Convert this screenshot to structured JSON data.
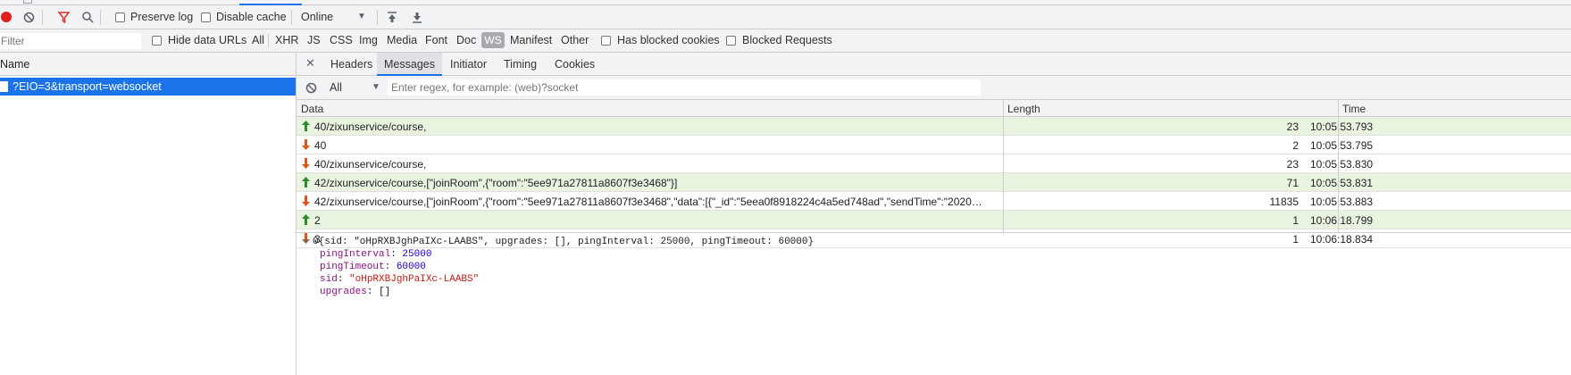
{
  "toolbar": {
    "preserve_log": "Preserve log",
    "disable_cache": "Disable cache",
    "throttle": "Online"
  },
  "filterbar": {
    "filter_placeholder": "Filter",
    "hide_data_urls": "Hide data URLs",
    "types": [
      "All",
      "XHR",
      "JS",
      "CSS",
      "Img",
      "Media",
      "Font",
      "Doc",
      "WS",
      "Manifest",
      "Other"
    ],
    "has_blocked_cookies": "Has blocked cookies",
    "blocked_requests": "Blocked Requests"
  },
  "left": {
    "column_name": "Name",
    "request": "?EIO=3&transport=websocket"
  },
  "detail_tabs": [
    "Headers",
    "Messages",
    "Initiator",
    "Timing",
    "Cookies"
  ],
  "messages_filter": {
    "type": "All",
    "regex_placeholder": "Enter regex, for example: (web)?socket"
  },
  "grid": {
    "headers": [
      "Data",
      "Length",
      "Time"
    ],
    "rows": [
      {
        "dir": "sent",
        "data": "40/zixunservice/course,",
        "length": "23",
        "time": "10:05:53.793"
      },
      {
        "dir": "recv",
        "data": "40",
        "length": "2",
        "time": "10:05:53.795"
      },
      {
        "dir": "recv",
        "data": "40/zixunservice/course,",
        "length": "23",
        "time": "10:05:53.830"
      },
      {
        "dir": "sent",
        "data": "42/zixunservice/course,[\"joinRoom\",{\"room\":\"5ee971a27811a8607f3e3468\"}]",
        "length": "71",
        "time": "10:05:53.831"
      },
      {
        "dir": "recv",
        "data": "42/zixunservice/course,[\"joinRoom\",{\"room\":\"5ee971a27811a8607f3e3468\",\"data\":[{\"_id\":\"5eea0f8918224c4a5ed748ad\",\"sendTime\":\"2020…",
        "length": "11835",
        "time": "10:05:53.883"
      },
      {
        "dir": "sent",
        "data": "2",
        "length": "1",
        "time": "10:06:18.799"
      },
      {
        "dir": "recv",
        "data": "3",
        "length": "1",
        "time": "10:06:18.834"
      }
    ]
  },
  "details": {
    "summary": "0{sid: \"oHpRXBJghPaIXc-LAABS\", upgrades: [], pingInterval: 25000, pingTimeout: 60000}",
    "props": [
      {
        "key": "pingInterval",
        "sep": ": ",
        "value": "25000",
        "kind": "num"
      },
      {
        "key": "pingTimeout",
        "sep": ": ",
        "value": "60000",
        "kind": "num"
      },
      {
        "key": "sid",
        "sep": ": ",
        "value": "\"oHpRXBJghPaIXc-LAABS\"",
        "kind": "str"
      },
      {
        "key": "upgrades",
        "sep": ": ",
        "value": "[]",
        "kind": "plain"
      }
    ]
  },
  "colors": {
    "record": "#e0201c",
    "accent": "#1a73e8",
    "sent_bg": "#e8f4e0",
    "up_arrow": "#2d8a2d",
    "down_arrow": "#d9591c"
  },
  "icons": [
    "record-icon",
    "clear-icon",
    "filter-icon",
    "search-icon",
    "dropdown-icon",
    "import-icon",
    "export-icon",
    "close-icon",
    "block-icon",
    "up-arrow-icon",
    "down-arrow-icon",
    "expand-triangle-icon"
  ]
}
